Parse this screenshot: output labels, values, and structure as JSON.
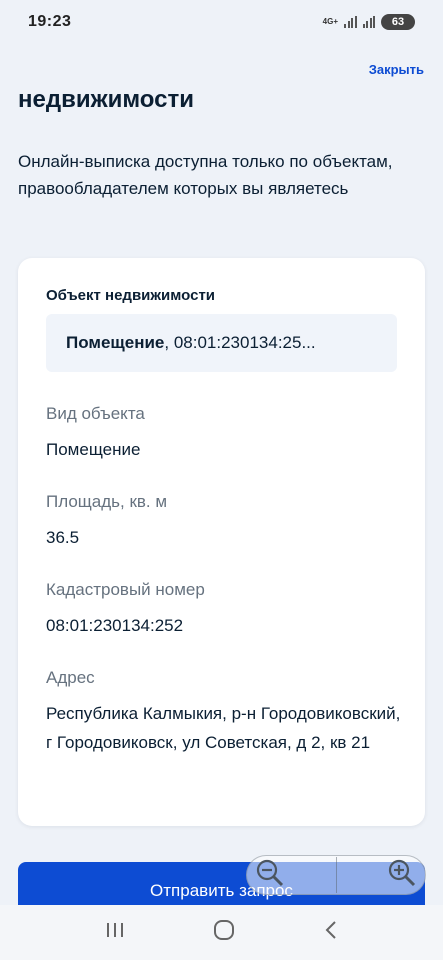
{
  "status_bar": {
    "time": "19:23",
    "network": "4G+",
    "battery": "63"
  },
  "header": {
    "close_label": "Закрыть"
  },
  "page": {
    "heading": "недвижимости",
    "intro": "Онлайн-выписка доступна только по объектам, правообладателем которых вы являетесь"
  },
  "card": {
    "object_label": "Объект недвижимости",
    "select": {
      "type": "Помещение",
      "number": ", 08:01:230134:25..."
    },
    "fields": [
      {
        "label": "Вид объекта",
        "value": "Помещение"
      },
      {
        "label": "Площадь, кв. м",
        "value": "36.5"
      },
      {
        "label": "Кадастровый номер",
        "value": "08:01:230134:252"
      },
      {
        "label": "Адрес",
        "value": "Республика Калмыкия, р-н Городовиковский, г Городовиковск, ул Советская, д 2, кв 21"
      }
    ]
  },
  "actions": {
    "submit_label": "Отправить запрос"
  },
  "zoom": {
    "zoom_out_icon": "zoom-out-icon",
    "zoom_in_icon": "zoom-in-icon"
  },
  "nav": {
    "recent_icon": "recent-apps-icon",
    "home_icon": "home-icon",
    "back_icon": "back-icon"
  },
  "colors": {
    "accent": "#0d4cd3",
    "background": "#eef2f8",
    "card": "#ffffff",
    "muted_text": "#66727f"
  }
}
